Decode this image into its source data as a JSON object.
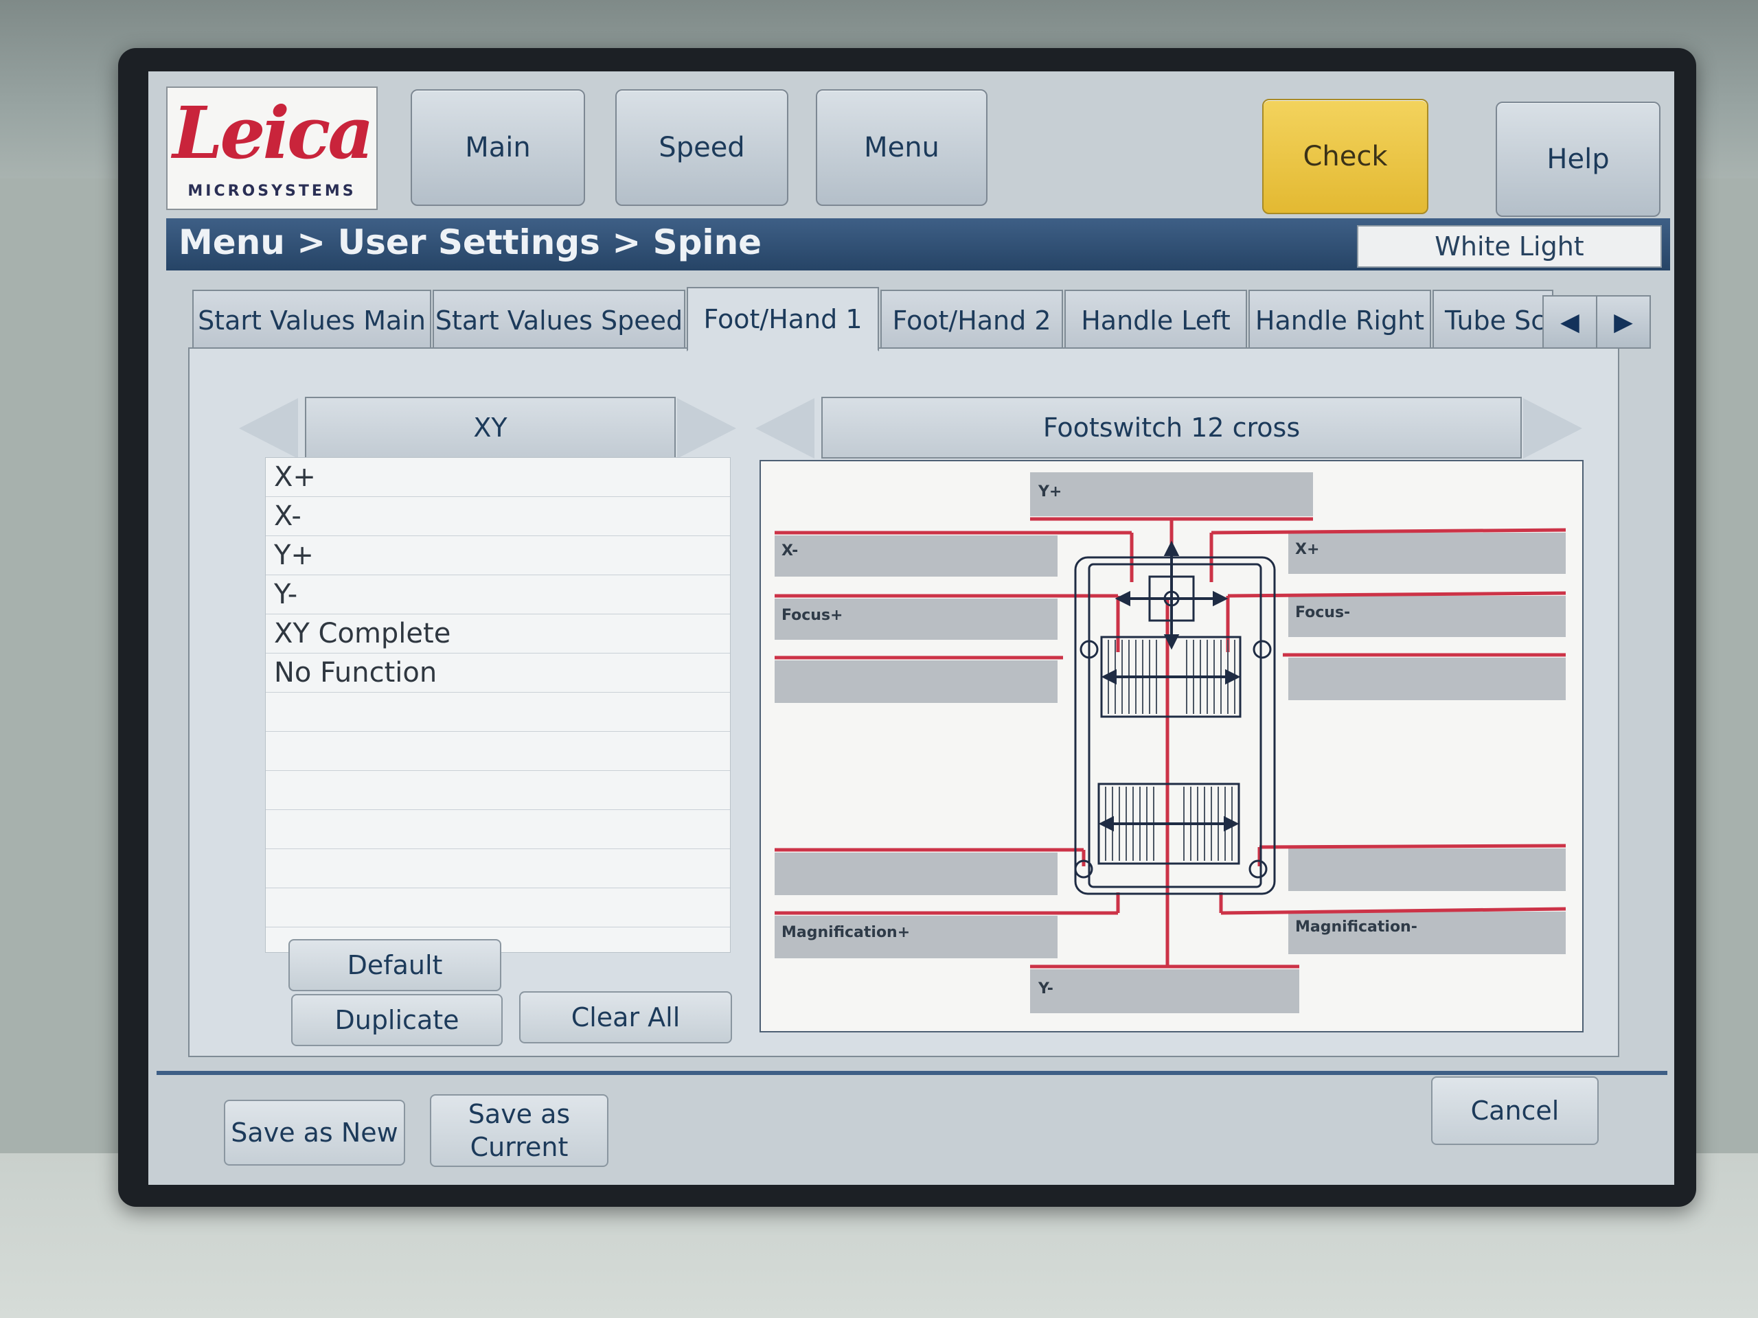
{
  "logo": {
    "brand": "Leica",
    "sub": "MICROSYSTEMS"
  },
  "header": {
    "main": "Main",
    "speed": "Speed",
    "menu": "Menu",
    "check": "Check",
    "help": "Help"
  },
  "breadcrumb": "Menu > User Settings > Spine",
  "light_mode": "White Light",
  "tabs": [
    {
      "label": "Start Values Main"
    },
    {
      "label": "Start Values Speed"
    },
    {
      "label": "Foot/Hand 1"
    },
    {
      "label": "Foot/Hand 2"
    },
    {
      "label": "Handle Left"
    },
    {
      "label": "Handle Right"
    },
    {
      "label": "Tube Sc"
    }
  ],
  "active_tab": "Foot/Hand 1",
  "left_selector": "XY",
  "right_selector": "Footswitch 12 cross",
  "functions": [
    "X+",
    "X-",
    "Y+",
    "Y-",
    "XY Complete",
    "No Function",
    "",
    "",
    "",
    "",
    "",
    ""
  ],
  "buttons": {
    "default": "Default",
    "duplicate": "Duplicate",
    "clear_all": "Clear All"
  },
  "footswitch_labels": {
    "y_plus": "Y+",
    "x_minus": "X-",
    "x_plus": "X+",
    "focus_plus": "Focus+",
    "focus_minus": "Focus-",
    "mag_plus": "Magnification+",
    "mag_minus": "Magnification-",
    "y_minus": "Y-"
  },
  "footer": {
    "save_new": "Save as New",
    "save_current_1": "Save as",
    "save_current_2": "Current",
    "cancel": "Cancel"
  },
  "colors": {
    "accent_bar": "#3e5f86",
    "check": "#e8c03c",
    "leader_lines": "#cc3347",
    "logo_red": "#c9243b"
  }
}
